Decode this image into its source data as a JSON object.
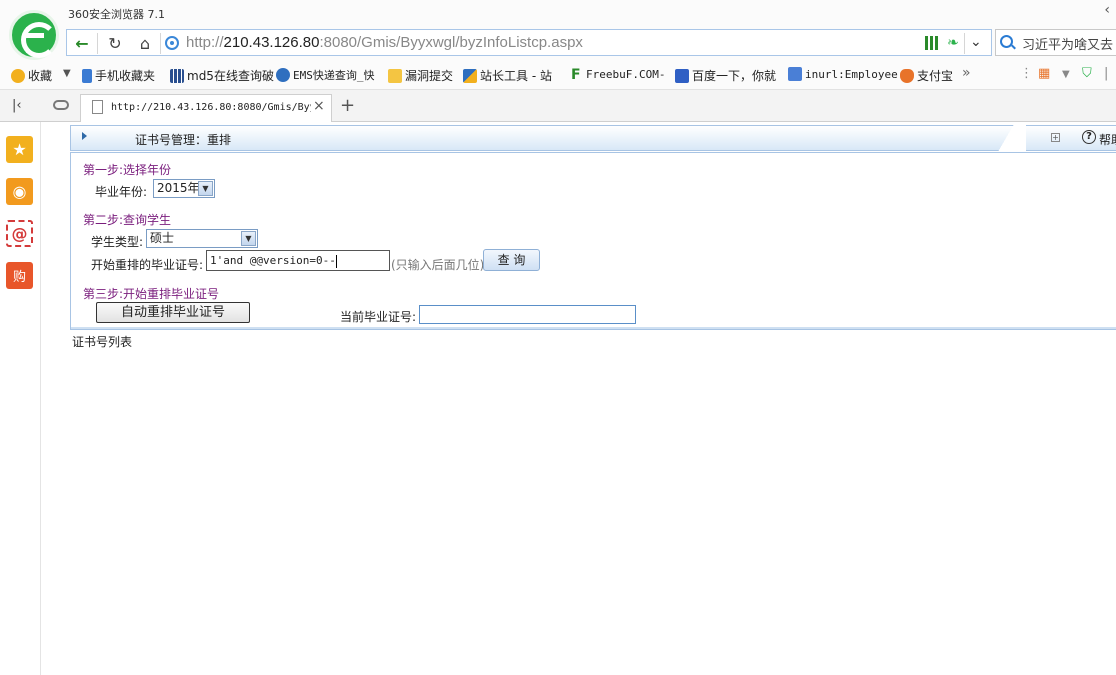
{
  "browser": {
    "app_title": "360安全浏览器 7.1",
    "url_prefix": "http://",
    "url_host": "210.43.126.80",
    "url_rest": ":8080/Gmis/Byyxwgl/byzInfoListcp.aspx",
    "search_text": "习近平为啥又去",
    "favorites": [
      "收藏",
      "手机收藏夹",
      "md5在线查询破",
      "EMS快递查询_快",
      "漏洞提交",
      "站长工具 - 站",
      "FreebuF.COM-",
      "百度一下，你就",
      "inurl:Employee",
      "支付宝"
    ],
    "tab_title": "http://210.43.126.80:8080/Gmis/Byyx",
    "colors": {
      "accent_green": "#2bb24c",
      "link_blue": "#2a7bd3"
    }
  },
  "page": {
    "header_title": "证书号管理：重排",
    "help_label": "帮助",
    "step1_title": "第一步:选择年份",
    "year_label": "毕业年份:",
    "year_value": "2015年",
    "step2_title": "第二步:查询学生",
    "student_type_label": "学生类型:",
    "student_type_value": "硕士",
    "start_cert_label": "开始重排的毕业证号:",
    "start_cert_value": "1'and @@version=0--",
    "start_cert_hint": "(只输入后面几位)",
    "query_button": "查 询",
    "step3_title": "第三步:开始重排毕业证号",
    "auto_button": "自动重排毕业证号",
    "current_cert_label": "当前毕业证号:",
    "current_cert_value": "",
    "list_label": "证书号列表",
    "colors": {
      "step_purple": "#7a1d7d",
      "panel_border": "#a8c4e4"
    }
  }
}
